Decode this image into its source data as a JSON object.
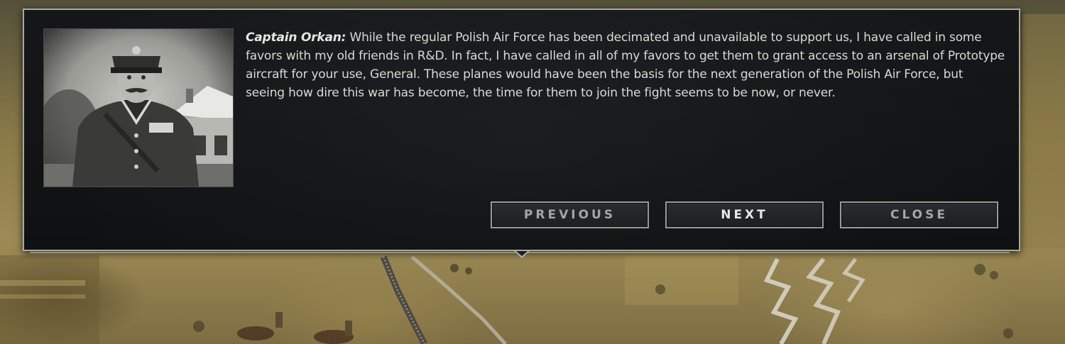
{
  "dialog": {
    "speaker": "Captain Orkan:",
    "message": "While the regular Polish Air Force has been decimated and unavailable to support us, I have called in some favors with my old friends in R&D.  In fact, I have called in all of my favors to get them to grant access to an arsenal of Prototype aircraft for your use, General.  These planes would have been the basis for the next generation of the Polish Air Force, but seeing how dire this war has become, the time for them to join the fight seems to be now, or never.",
    "portrait_icon": "officer-portrait"
  },
  "buttons": {
    "previous_label": "PREVIOUS",
    "next_label": "NEXT",
    "close_label": "CLOSE"
  },
  "colors": {
    "panel_bg": "#1b1e21",
    "panel_border": "#a9a9a4",
    "text": "#d9d9d4",
    "button_enabled_text": "#e8e8e4",
    "button_disabled_text": "#a6a6a2"
  }
}
